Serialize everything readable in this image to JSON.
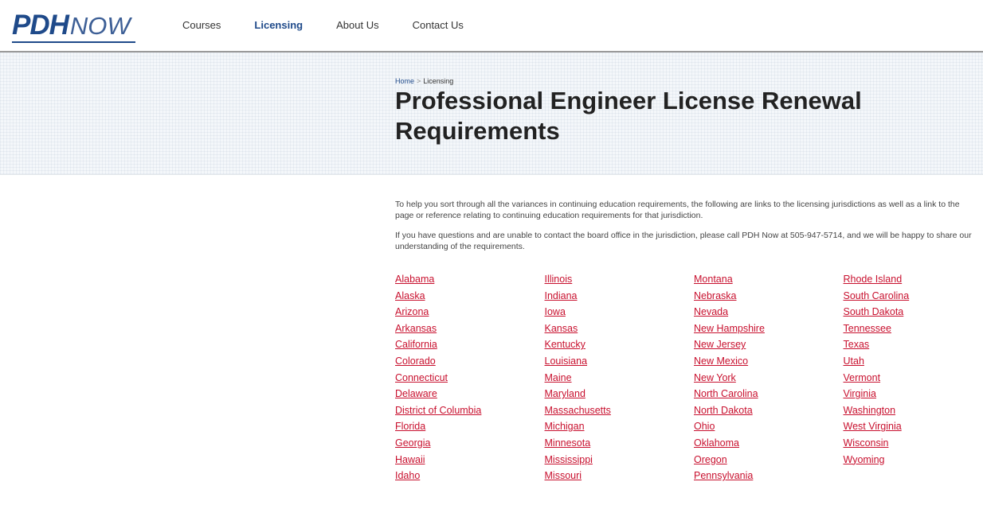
{
  "header": {
    "logo": {
      "pdh": "PDH",
      "now": "NOW"
    },
    "nav": [
      {
        "label": "Courses",
        "active": false
      },
      {
        "label": "Licensing",
        "active": true
      },
      {
        "label": "About Us",
        "active": false
      },
      {
        "label": "Contact Us",
        "active": false
      }
    ]
  },
  "breadcrumb": {
    "home": "Home",
    "separator": ">",
    "current": "Licensing"
  },
  "title": "Professional Engineer License Renewal Requirements",
  "intro": {
    "p1": "To help you sort through all the variances in continuing education requirements, the following are links to the licensing jurisdictions as well as a link to the page or reference relating to continuing education requirements for that jurisdiction.",
    "p2": "If you have questions and are unable to contact the board office in the jurisdiction, please call PDH Now at 505-947-5714, and we will be happy to share our understanding of the requirements."
  },
  "states": {
    "col1": [
      "Alabama",
      "Alaska",
      "Arizona",
      "Arkansas",
      "California",
      "Colorado",
      "Connecticut",
      "Delaware",
      "District of Columbia",
      "Florida",
      "Georgia",
      "Hawaii",
      "Idaho"
    ],
    "col2": [
      "Illinois",
      "Indiana",
      "Iowa",
      "Kansas",
      "Kentucky",
      "Louisiana",
      "Maine",
      "Maryland",
      "Massachusetts",
      "Michigan",
      "Minnesota",
      "Mississippi",
      "Missouri"
    ],
    "col3": [
      "Montana",
      "Nebraska",
      "Nevada",
      "New Hampshire",
      "New Jersey",
      "New Mexico",
      "New York",
      "North Carolina",
      "North Dakota",
      "Ohio",
      "Oklahoma",
      "Oregon",
      "Pennsylvania"
    ],
    "col4": [
      "Rhode Island",
      "South Carolina",
      "South Dakota",
      "Tennessee",
      "Texas",
      "Utah",
      "Vermont",
      "Virginia",
      "Washington",
      "West Virginia",
      "Wisconsin",
      "Wyoming"
    ]
  },
  "colors": {
    "brand_blue": "#1f4a8a",
    "link_red": "#c8102e"
  }
}
